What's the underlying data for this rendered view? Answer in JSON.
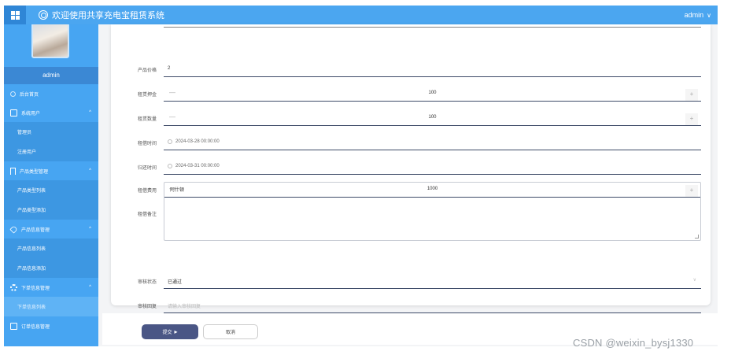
{
  "header": {
    "title": "欢迎使用共享充电宝租赁系统",
    "user": "admin",
    "user_chevron": "∨",
    "menu_icon": "grid-icon",
    "logo_icon": "logo-icon"
  },
  "sidebar": {
    "username": "admin",
    "items": [
      {
        "label": "后台首页",
        "type": "item",
        "icon": "home-icon"
      },
      {
        "label": "系统用户",
        "type": "group",
        "icon": "monitor-icon",
        "caret": "^"
      },
      {
        "label": "管理员",
        "type": "sub"
      },
      {
        "label": "注册用户",
        "type": "sub"
      },
      {
        "label": "产品类型管理",
        "type": "group",
        "icon": "bookmark-icon",
        "caret": "^"
      },
      {
        "label": "产品类型列表",
        "type": "sub"
      },
      {
        "label": "产品类型添加",
        "type": "sub"
      },
      {
        "label": "产品信息管理",
        "type": "group",
        "icon": "tag-icon",
        "caret": "^"
      },
      {
        "label": "产品信息列表",
        "type": "sub"
      },
      {
        "label": "产品信息添加",
        "type": "sub"
      },
      {
        "label": "下单信息管理",
        "type": "group",
        "icon": "gear-icon",
        "caret": "^"
      },
      {
        "label": "下单信息列表",
        "type": "sub",
        "active": true
      },
      {
        "label": "订单信息管理",
        "type": "group",
        "icon": "check-icon"
      }
    ]
  },
  "form": {
    "price_label": "产品价格",
    "price_value": "2",
    "deposit_label": "租赁押金",
    "deposit_value": "100",
    "quantity_label": "租赁数量",
    "quantity_value": "100",
    "rent_time_label": "租借时间",
    "rent_time_value": "2024-03-28 00:00:00",
    "return_time_label": "归还时间",
    "return_time_value": "2024-03-31 00:00:00",
    "fee_label": "租借费用",
    "fee_value": "1000",
    "remark_label": "租借备注",
    "remark_value": "阿什顿",
    "status_label": "审核状态",
    "status_value": "已通过",
    "reply_label": "审核回复",
    "reply_placeholder": "请输入审核回复",
    "minus": "—",
    "plus": "+"
  },
  "actions": {
    "submit_label": "提交",
    "cancel_label": "取消"
  },
  "watermark": "CSDN @weixin_bysj1330"
}
